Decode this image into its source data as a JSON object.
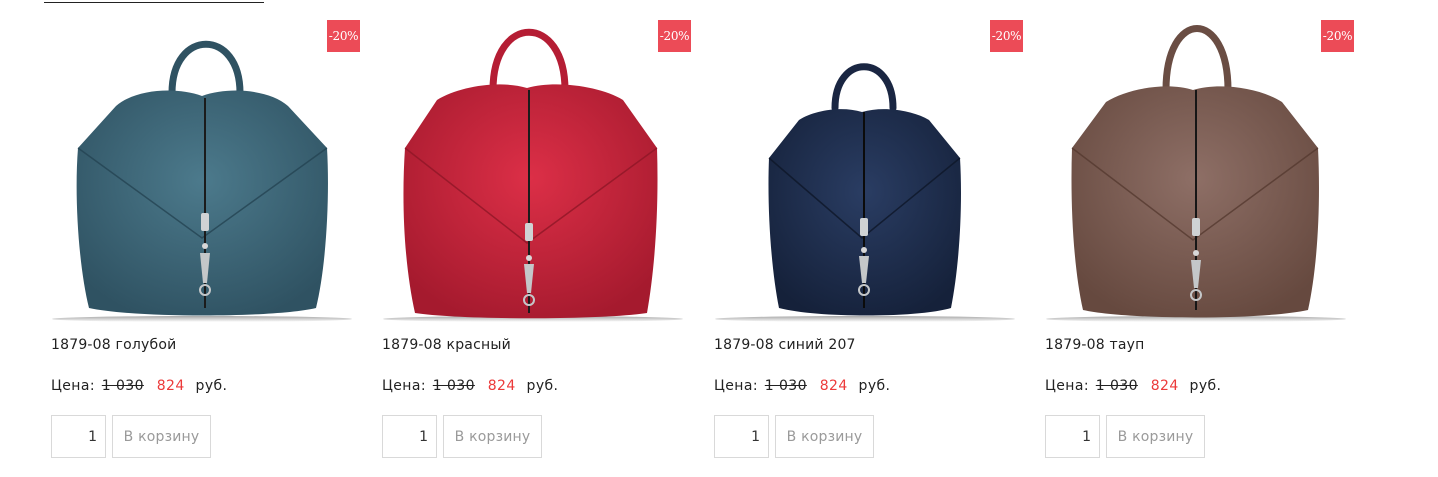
{
  "products": [
    {
      "title": "1879-08 голубой",
      "badge": "-20%",
      "price_label": "Цена:",
      "old_price": "1 030",
      "new_price": "824",
      "currency": "руб.",
      "quantity": "1",
      "cart_label": "В корзину",
      "color": "#3d6577",
      "image_icon": "backpack-image"
    },
    {
      "title": "1879-08 красный",
      "badge": "-20%",
      "price_label": "Цена:",
      "old_price": "1 030",
      "new_price": "824",
      "currency": "руб.",
      "quantity": "1",
      "cart_label": "В корзину",
      "color": "#c8203a",
      "image_icon": "backpack-image"
    },
    {
      "title": "1879-08 синий 207",
      "badge": "-20%",
      "price_label": "Цена:",
      "old_price": "1 030",
      "new_price": "824",
      "currency": "руб.",
      "quantity": "1",
      "cart_label": "В корзину",
      "color": "#1d2c4d",
      "image_icon": "backpack-image"
    },
    {
      "title": "1879-08 тауп",
      "badge": "-20%",
      "price_label": "Цена:",
      "old_price": "1 030",
      "new_price": "824",
      "currency": "руб.",
      "quantity": "1",
      "cart_label": "В корзину",
      "color": "#7d5f56",
      "image_icon": "backpack-image"
    }
  ],
  "colors": {
    "badge": "#ec4b57",
    "new_price": "#ec3a3a",
    "button_text": "#9a9a9a",
    "border": "#d9d9d9"
  }
}
